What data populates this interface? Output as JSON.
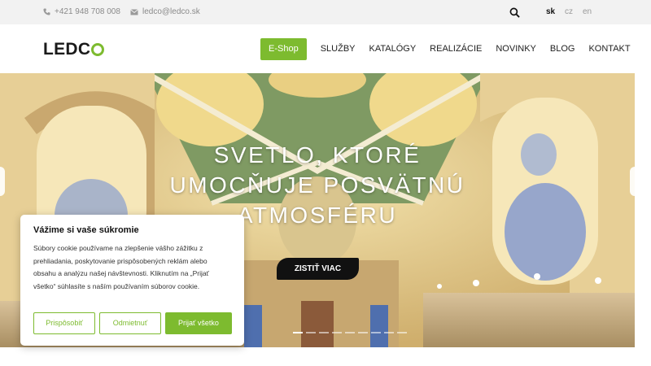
{
  "topbar": {
    "phone": "+421 948 708 008",
    "email": "ledco@ledco.sk",
    "search_icon": "search-icon",
    "languages": [
      "sk",
      "cz",
      "en"
    ],
    "active_language": "sk"
  },
  "header": {
    "logo_text": "LEDC",
    "eshop_label": "E-Shop",
    "nav": [
      "SLUŽBY",
      "KATALÓGY",
      "REALIZÁCIE",
      "NOVINKY",
      "BLOG",
      "KONTAKT"
    ]
  },
  "hero": {
    "title": "SVETLO, KTORÉ UMOCŇUJE POSVÄTNÚ ATMOSFÉRU",
    "cta_label": "ZISTIŤ VIAC",
    "slides_count": 9,
    "active_slide": 1
  },
  "cookie": {
    "title": "Vážime si vaše súkromie",
    "text": "Súbory cookie používame na zlepšenie vášho zážitku z prehliadania, poskytovanie prispôsobených reklám alebo obsahu a analýzu našej návštevnosti. Kliknutím na „Prijať všetko“ súhlasíte s naším používaním súborov cookie.",
    "customize_label": "Prispôsobiť",
    "reject_label": "Odmietnuť",
    "accept_label": "Prijať všetko"
  },
  "colors": {
    "accent": "#7dbb2f",
    "topbar_bg": "#f2f2f2",
    "cta_bg": "#111111"
  }
}
